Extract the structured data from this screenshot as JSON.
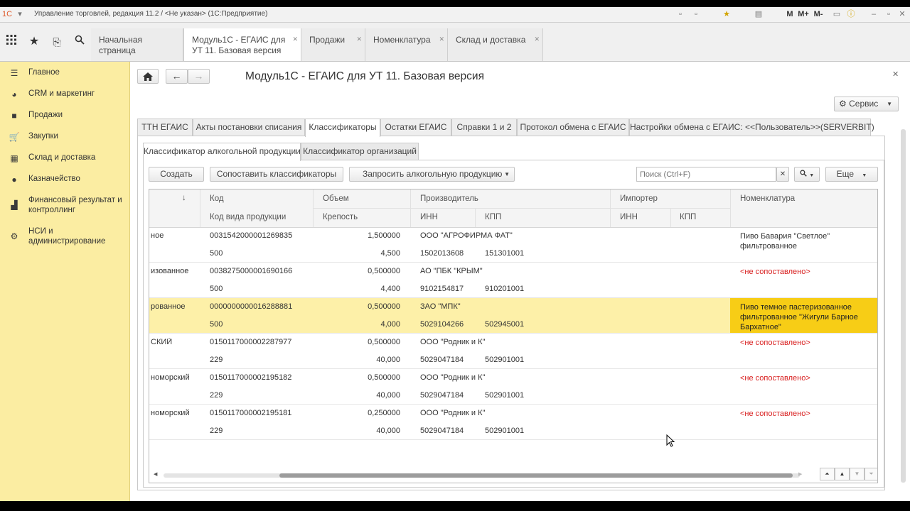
{
  "window": {
    "title": "Управление торговлей, редакция 11.2 / <Не указан> (1С:Предприятие)",
    "controls": [
      "M",
      "M+",
      "M-"
    ]
  },
  "open_tabs": [
    {
      "label": "Начальная страница",
      "closable": false
    },
    {
      "label": "Модуль1С - ЕГАИС для УТ 11. Базовая версия",
      "closable": true,
      "active": true
    },
    {
      "label": "Продажи",
      "closable": true
    },
    {
      "label": "Номенклатура",
      "closable": true
    },
    {
      "label": "Склад и доставка",
      "closable": true
    }
  ],
  "sidebar": {
    "items": [
      {
        "label": "Главное",
        "icon": "menu-icon"
      },
      {
        "label": "CRM и маркетинг",
        "icon": "pie-chart-icon"
      },
      {
        "label": "Продажи",
        "icon": "bag-icon"
      },
      {
        "label": "Закупки",
        "icon": "cart-icon"
      },
      {
        "label": "Склад и доставка",
        "icon": "warehouse-icon"
      },
      {
        "label": "Казначейство",
        "icon": "coin-icon"
      },
      {
        "label": "Финансовый результат и контроллинг",
        "icon": "bar-chart-icon"
      },
      {
        "label": "НСИ и администрирование",
        "icon": "gear-icon"
      }
    ]
  },
  "form": {
    "title": "Модуль1С - ЕГАИС для УТ 11. Базовая версия",
    "service_button": "Сервис",
    "tabs": [
      "ТТН ЕГАИС",
      "Акты постановки списания",
      "Классификаторы",
      "Остатки ЕГАИС",
      "Справки 1 и 2",
      "Протокол обмена с ЕГАИС",
      "Настройки обмена с ЕГАИС: <<Пользователь>>(SERVERBIT)"
    ],
    "active_tab": "Классификаторы",
    "subtabs": [
      "Классификатор алкогольной продукции",
      "Классификатор организаций"
    ],
    "active_subtab": "Классификатор алкогольной продукции",
    "toolbar": {
      "create": "Создать",
      "match": "Сопоставить классификаторы",
      "request": "Запросить алкогольную продукцию",
      "search_placeholder": "Поиск (Ctrl+F)",
      "more": "Еще"
    }
  },
  "grid": {
    "headers": {
      "sort_arrow": "↓",
      "code": "Код",
      "volume": "Объем",
      "producer": "Производитель",
      "importer": "Импортер",
      "nomenclature": "Номенклатура",
      "code_type": "Код вида продукции",
      "strength": "Крепость",
      "inn": "ИНН",
      "kpp": "КПП",
      "imp_inn": "ИНН",
      "imp_kpp": "КПП"
    },
    "rows": [
      {
        "name": "ное",
        "code": "0031542000001269835",
        "volume": "1,500000",
        "producer": "ООО \"АГРОФИРМА ФАТ\"",
        "code_type": "500",
        "strength": "4,500",
        "inn": "1502013608",
        "kpp": "151301001",
        "nomenclature": "Пиво Бавария \"Светлое\" фильтрованное",
        "matched": true
      },
      {
        "name": "изованное",
        "code": "0038275000001690166",
        "volume": "0,500000",
        "producer": "АО \"ПБК \"КРЫМ\"",
        "code_type": "500",
        "strength": "4,400",
        "inn": "9102154817",
        "kpp": "910201001",
        "nomenclature": "<не сопоставлено>",
        "matched": false
      },
      {
        "name": "рованное",
        "code": "0000000000016288881",
        "volume": "0,500000",
        "producer": "ЗАО \"МПК\"",
        "code_type": "500",
        "strength": "4,000",
        "inn": "5029104266",
        "kpp": "502945001",
        "nomenclature": "Пиво темное пастеризованное фильтрованное \"Жигули Барное Бархатное\"",
        "matched": true,
        "selected": true
      },
      {
        "name": "СКИЙ",
        "code": "0150117000002287977",
        "volume": "0,500000",
        "producer": "ООО \"Родник и К\"",
        "code_type": "229",
        "strength": "40,000",
        "inn": "5029047184",
        "kpp": "502901001",
        "nomenclature": "<не сопоставлено>",
        "matched": false
      },
      {
        "name": "номорский",
        "code": "0150117000002195182",
        "volume": "0,500000",
        "producer": "ООО \"Родник и К\"",
        "code_type": "229",
        "strength": "40,000",
        "inn": "5029047184",
        "kpp": "502901001",
        "nomenclature": "<не сопоставлено>",
        "matched": false
      },
      {
        "name": "номорский",
        "code": "0150117000002195181",
        "volume": "0,250000",
        "producer": "ООО \"Родник и К\"",
        "code_type": "229",
        "strength": "40,000",
        "inn": "5029047184",
        "kpp": "502901001",
        "nomenclature": "<не сопоставлено>",
        "matched": false
      }
    ]
  },
  "colors": {
    "sidebar_bg": "#fbeda2",
    "selected_row": "#fdf0a8",
    "selected_cell": "#f7cd16",
    "unmatched_text": "#d81e1e"
  }
}
